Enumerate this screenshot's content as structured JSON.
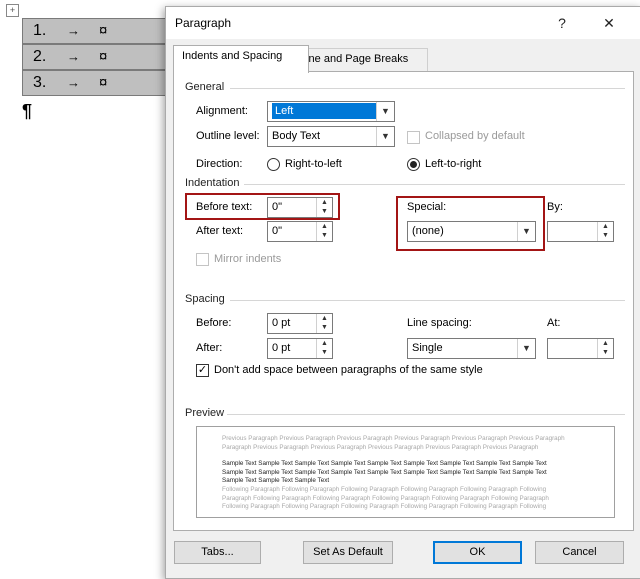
{
  "document": {
    "rows": [
      {
        "num": "1.",
        "arrow": "→",
        "cell_mark": "¤"
      },
      {
        "num": "2.",
        "arrow": "→",
        "cell_mark": "¤"
      },
      {
        "num": "3.",
        "arrow": "→",
        "cell_mark": "¤"
      }
    ],
    "move_handle": "+",
    "pilcrow": "¶"
  },
  "dialog": {
    "title": "Paragraph",
    "help": "?",
    "close": "✕",
    "tabs": [
      "Indents and Spacing",
      "Line and Page Breaks"
    ],
    "general": {
      "heading": "General",
      "alignment_label": "Alignment:",
      "alignment_value": "Left",
      "outline_label": "Outline level:",
      "outline_value": "Body Text",
      "collapsed_label": "Collapsed by default",
      "direction_label": "Direction:",
      "rtl_label": "Right-to-left",
      "ltr_label": "Left-to-right"
    },
    "indentation": {
      "heading": "Indentation",
      "before_label": "Before text:",
      "before_value": "0\"",
      "after_label": "After text:",
      "after_value": "0\"",
      "special_label": "Special:",
      "special_value": "(none)",
      "by_label": "By:",
      "by_value": "",
      "mirror_label": "Mirror indents"
    },
    "spacing": {
      "heading": "Spacing",
      "before_label": "Before:",
      "before_value": "0 pt",
      "after_label": "After:",
      "after_value": "0 pt",
      "line_spacing_label": "Line spacing:",
      "line_spacing_value": "Single",
      "at_label": "At:",
      "at_value": "",
      "dont_add_label": "Don't add space between paragraphs of the same style"
    },
    "preview": {
      "heading": "Preview",
      "prev_lines": [
        "Previous Paragraph Previous Paragraph Previous Paragraph Previous Paragraph Previous Paragraph Previous Paragraph",
        "Paragraph Previous Paragraph Previous Paragraph Previous Paragraph Previous Paragraph Previous Paragraph"
      ],
      "sample_lines": [
        "Sample Text Sample Text Sample Text Sample Text Sample Text Sample Text Sample Text Sample Text Sample Text",
        "Sample Text Sample Text Sample Text Sample Text Sample Text Sample Text Sample Text Sample Text Sample Text",
        "Sample Text Sample Text Sample Text"
      ],
      "follow_lines": [
        "Following Paragraph Following Paragraph Following Paragraph Following Paragraph Following Paragraph Following",
        "Paragraph Following Paragraph Following Paragraph Following Paragraph Following Paragraph Following Paragraph",
        "Following Paragraph Following Paragraph Following Paragraph Following Paragraph Following Paragraph Following"
      ]
    },
    "buttons": {
      "tabs": "Tabs...",
      "set_default": "Set As Default",
      "ok": "OK",
      "cancel": "Cancel"
    },
    "colors": {
      "highlight_box": "#a31515",
      "selection": "#0078d7"
    }
  }
}
